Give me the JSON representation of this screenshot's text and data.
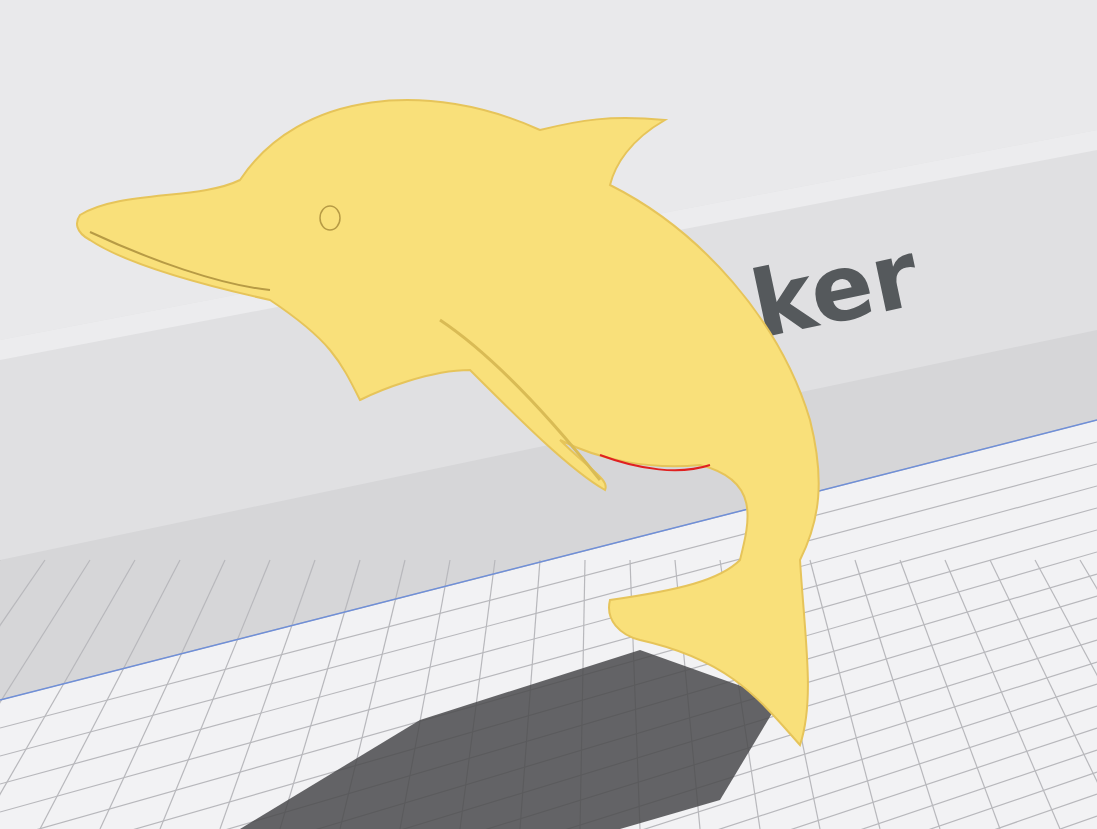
{
  "viewport": {
    "logo_text": "ker"
  }
}
